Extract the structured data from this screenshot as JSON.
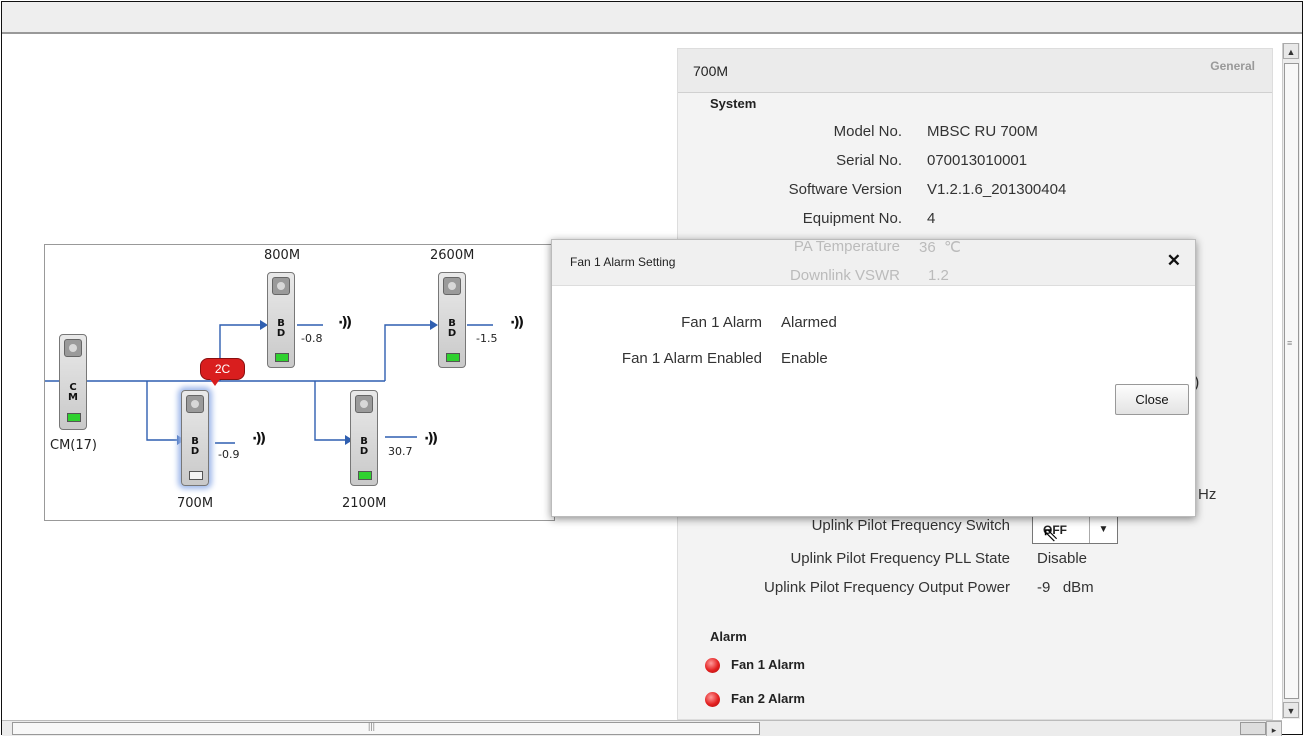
{
  "topology": {
    "cm": {
      "letters": "C\nM",
      "label": "CM(17)"
    },
    "modules": [
      {
        "name": "800M",
        "letters": "B\nD",
        "value": "-0.8",
        "led": "on"
      },
      {
        "name": "2600M",
        "letters": "B\nD",
        "value": "-1.5",
        "led": "on"
      },
      {
        "name": "700M",
        "letters": "B\nD",
        "value": "-0.9",
        "led": "off"
      },
      {
        "name": "2100M",
        "letters": "B\nD",
        "value": "30.7",
        "led": "on"
      }
    ],
    "antenna_glyph": "·))",
    "alarm_bubble": "2C"
  },
  "panel": {
    "title": "700M",
    "tab": "General",
    "system_heading": "System",
    "rows": [
      {
        "label": "Model No.",
        "value": "MBSC RU 700M"
      },
      {
        "label": "Serial No.",
        "value": "070013010001"
      },
      {
        "label": "Software Version",
        "value": "V1.2.1.6_201300404"
      },
      {
        "label": "Equipment No.",
        "value": "4"
      },
      {
        "label": "PA Temperature",
        "value": "36  ℃"
      },
      {
        "label": "Downlink VSWR",
        "value": "1.2"
      }
    ],
    "partial_right": ")",
    "partial_hz": "Hz",
    "pilot_rows": [
      {
        "label": "Uplink Pilot Frequency Switch",
        "value": "OFF"
      },
      {
        "label": "Uplink Pilot Frequency PLL State",
        "value": "Disable"
      },
      {
        "label": "Uplink Pilot Frequency Output Power",
        "value": "-9   dBm"
      }
    ],
    "alarm_heading": "Alarm",
    "alarms": [
      "Fan 1 Alarm",
      "Fan 2 Alarm"
    ],
    "alarm_color": "#e32020"
  },
  "dialog": {
    "title": "Fan 1 Alarm Setting",
    "close_x": "✕",
    "rows": [
      {
        "label": "Fan 1 Alarm",
        "value": "Alarmed"
      },
      {
        "label": "Fan 1 Alarm Enabled",
        "value": "Enable"
      }
    ],
    "close_button": "Close"
  },
  "scroll": {
    "up": "▲",
    "down": "▼",
    "right": "▸",
    "grip": "|||"
  },
  "colors": {
    "link_line": "#2f5fb0",
    "led_on": "#2fd12f",
    "alarm": "#d91e1e"
  }
}
